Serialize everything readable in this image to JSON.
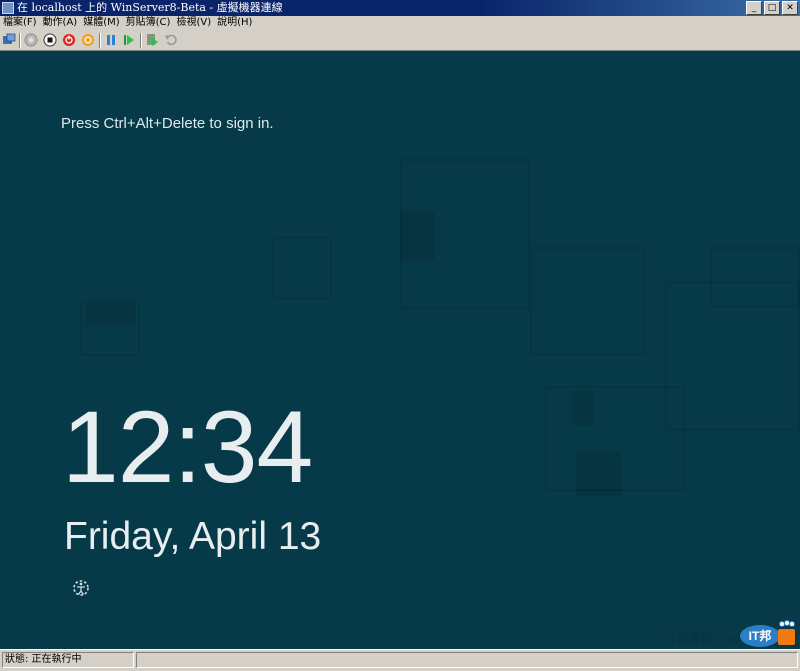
{
  "window": {
    "title": "在 localhost 上的 WinServer8-Beta - 虛擬機器連線",
    "buttons": {
      "minimize": "_",
      "maximize": "□",
      "close": "✕"
    }
  },
  "menubar": {
    "items": [
      "檔案(F)",
      "動作(A)",
      "媒體(M)",
      "剪貼簿(C)",
      "檢視(V)",
      "說明(H)"
    ]
  },
  "toolbar": {
    "icons": [
      "ctrl-alt-del-icon",
      "start-icon",
      "turn-off-icon",
      "shutdown-icon",
      "save-icon",
      "pause-icon",
      "resume-icon",
      "snapshot-icon",
      "revert-icon"
    ]
  },
  "lockscreen": {
    "prompt": "Press Ctrl+Alt+Delete to sign in.",
    "time": "12:34",
    "date": "Friday, April 13",
    "background_color": "#073a49",
    "text_color": "#e8eef0"
  },
  "watermark": {
    "member_text": "IT邦會員：jay",
    "logo_text": "IT邦"
  },
  "statusbar": {
    "status_text": "狀態: 正在執行中"
  }
}
